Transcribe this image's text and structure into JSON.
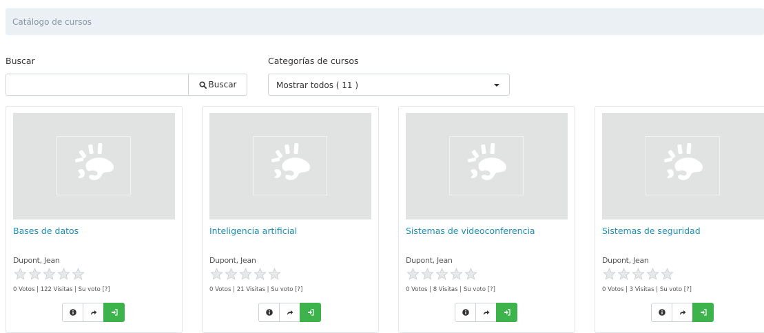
{
  "breadcrumb": {
    "label": "Catálogo de cursos"
  },
  "search": {
    "label": "Buscar",
    "value": "",
    "placeholder": "",
    "button_label": "Buscar"
  },
  "categories": {
    "label": "Categorías de cursos",
    "selected": "Mostrar todos ( 11 )"
  },
  "courses": [
    {
      "title": "Bases de datos",
      "author": "Dupont, Jean",
      "rating": 0,
      "votes_line": "0 Votos | 122 Visitas | Su voto [?]"
    },
    {
      "title": "Inteligencia artificial",
      "author": "Dupont, Jean",
      "rating": 0,
      "votes_line": "0 Votos | 21 Visitas | Su voto [?]"
    },
    {
      "title": "Sistemas de videoconferencia",
      "author": "Dupont, Jean",
      "rating": 0,
      "votes_line": "0 Votos | 8 Visitas | Su voto [?]"
    },
    {
      "title": "Sistemas de seguridad",
      "author": "Dupont, Jean",
      "rating": 0,
      "votes_line": "0 Votos | 3 Visitas | Su voto [?]"
    }
  ],
  "colors": {
    "link": "#1b8fb8",
    "subscribe_button": "#3cb44b",
    "thumbnail_bg": "#e1e3e3",
    "breadcrumb_bg": "#eaf0f4"
  },
  "icons": {
    "search_button": "search-icon",
    "card_buttons": [
      "info-icon",
      "share-icon",
      "sign-in-icon"
    ],
    "thumbnail": "chamilo-logo-icon",
    "rating": "star-icon"
  }
}
